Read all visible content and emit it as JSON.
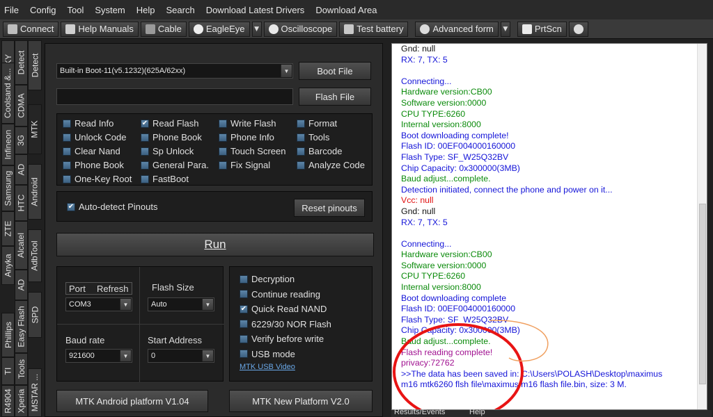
{
  "menu": [
    "File",
    "Config",
    "Tool",
    "System",
    "Help",
    "Search",
    "Download Latest Drivers",
    "Download Area"
  ],
  "toolbar": {
    "connect": "Connect",
    "help_manuals": "Help Manuals",
    "cable": "Cable",
    "eagleeye": "EagleEye",
    "oscilloscope": "Oscilloscope",
    "test_battery": "Test battery",
    "advanced_form": "Advanced form",
    "prtscn": "PrtScn"
  },
  "vtabs_outer": [
    "SKY",
    "Coolsand &...",
    "Infineon",
    "Samsung",
    "ZTE",
    "Anyka",
    "Phillips",
    "TI",
    "R4904"
  ],
  "vtabs_outer2": [
    "Detect",
    "CDMA",
    "3G",
    "AD",
    "HTC",
    "Alcatel",
    "AD",
    "Easy Flash",
    "Tools",
    "Xperia"
  ],
  "vtabs_inner": [
    "MTK",
    "Android",
    "AdbTool",
    "SPD",
    "MSTAR ..."
  ],
  "boot": {
    "selected": "Built-in Boot-11(v5.1232)(625A/62xx)",
    "boot_file_btn": "Boot File",
    "flash_file_value": "",
    "flash_file_btn": "Flash File"
  },
  "options": [
    {
      "label": "Read Info",
      "checked": false
    },
    {
      "label": "Read Flash",
      "checked": true
    },
    {
      "label": "Write Flash",
      "checked": false
    },
    {
      "label": "Format",
      "checked": false
    },
    {
      "label": "Unlock Code",
      "checked": false
    },
    {
      "label": "Phone Book",
      "checked": false
    },
    {
      "label": "Phone Info",
      "checked": false
    },
    {
      "label": "Tools",
      "checked": false
    },
    {
      "label": "Clear Nand",
      "checked": false
    },
    {
      "label": "Sp Unlock",
      "checked": false
    },
    {
      "label": "Touch Screen",
      "checked": false
    },
    {
      "label": "Barcode",
      "checked": false
    },
    {
      "label": "Phone Book",
      "checked": false
    },
    {
      "label": "General Para.",
      "checked": false
    },
    {
      "label": "Fix Signal",
      "checked": false
    },
    {
      "label": "Analyze Code",
      "checked": false
    },
    {
      "label": "One-Key Root",
      "checked": false
    },
    {
      "label": "FastBoot",
      "checked": false
    }
  ],
  "pinouts": {
    "auto_detect": "Auto-detect Pinouts",
    "reset": "Reset pinouts"
  },
  "run": "Run",
  "port": {
    "port_label": "Port",
    "refresh_label": "Refresh",
    "value": "COM3"
  },
  "flash_size": {
    "label": "Flash Size",
    "value": "Auto"
  },
  "baud": {
    "label": "Baud rate",
    "value": "921600"
  },
  "start_addr": {
    "label": "Start Address",
    "value": "0"
  },
  "extra_options": [
    {
      "label": "Decryption",
      "checked": false
    },
    {
      "label": "Continue reading",
      "checked": false
    },
    {
      "label": "Quick Read NAND",
      "checked": true
    },
    {
      "label": "6229/30 NOR Flash",
      "checked": false
    },
    {
      "label": "Verify before write",
      "checked": false
    },
    {
      "label": "USB mode",
      "checked": false
    }
  ],
  "usb_video_link": "MTK USB Video",
  "platform_buttons": {
    "android": "MTK Android platform V1.04",
    "new": "MTK New Platform V2.0"
  },
  "log": [
    {
      "text": "Gnd: null",
      "color": "black"
    },
    {
      "text": "RX: 7, TX: 5",
      "color": "blue"
    },
    {
      "text": "",
      "color": "black"
    },
    {
      "text": "Connecting...",
      "color": "blue"
    },
    {
      "text": "Hardware version:CB00",
      "color": "green"
    },
    {
      "text": "Software version:0000",
      "color": "green"
    },
    {
      "text": "CPU TYPE:6260",
      "color": "green"
    },
    {
      "text": "Internal version:8000",
      "color": "green"
    },
    {
      "text": "Boot downloading complete!",
      "color": "blue"
    },
    {
      "text": "Flash ID: 00EF004000160000",
      "color": "blue"
    },
    {
      "text": "Flash Type: SF_W25Q32BV",
      "color": "blue"
    },
    {
      "text": "Chip Capacity: 0x300000(3MB)",
      "color": "blue"
    },
    {
      "text": "Baud adjust...complete.",
      "color": "green"
    },
    {
      "text": "Detection initiated, connect the phone and power on it...",
      "color": "blue"
    },
    {
      "text": "Vcc: null",
      "color": "red"
    },
    {
      "text": "Gnd: null",
      "color": "black"
    },
    {
      "text": "RX: 7, TX: 5",
      "color": "blue"
    },
    {
      "text": "",
      "color": "black"
    },
    {
      "text": "Connecting...",
      "color": "blue"
    },
    {
      "text": "Hardware version:CB00",
      "color": "green"
    },
    {
      "text": "Software version:0000",
      "color": "green"
    },
    {
      "text": "CPU TYPE:6260",
      "color": "green"
    },
    {
      "text": "Internal version:8000",
      "color": "green"
    },
    {
      "text": "Boot downloading complete",
      "color": "blue"
    },
    {
      "text": "Flash ID: 00EF004000160000",
      "color": "blue"
    },
    {
      "text": "Flash Type: SF_W25Q32BV",
      "color": "blue"
    },
    {
      "text": "Chip Capacity: 0x300000(3MB)",
      "color": "blue"
    },
    {
      "text": "Baud adjust...complete.",
      "color": "green"
    },
    {
      "text": "Flash reading complete!",
      "color": "purple"
    },
    {
      "text": "privacy:72762",
      "color": "purple"
    },
    {
      "text": ">>The data has been saved in: C:\\Users\\POLASH\\Desktop\\maximus",
      "color": "blue"
    },
    {
      "text": "m16 mtk6260 flsh file\\maximus m16 flash file.bin, size: 3 M.",
      "color": "blue"
    }
  ],
  "bottom_tabs": [
    "Results/Events",
    "Help"
  ]
}
